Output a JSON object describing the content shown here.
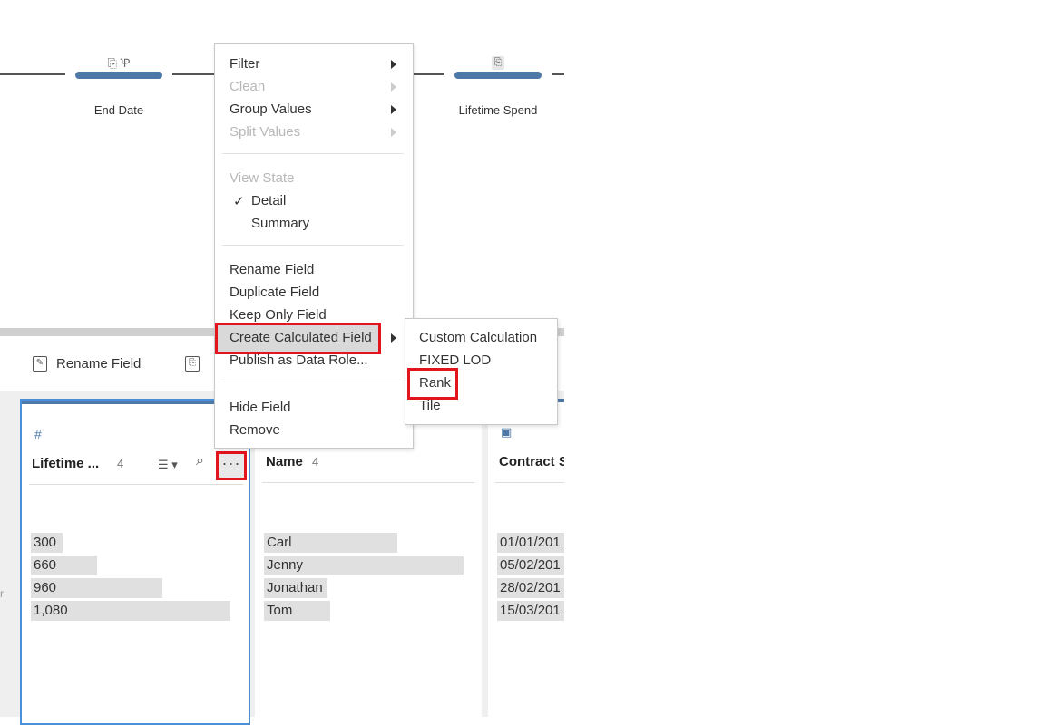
{
  "flow": {
    "node_end_date": {
      "label": "End Date",
      "icons": [
        "field-icon",
        "clean-icon"
      ]
    },
    "node_lifetime_spend": {
      "label": "Lifetime Spend",
      "icons": [
        "field-icon"
      ]
    }
  },
  "toolbar": {
    "rename_label": "Rename Field"
  },
  "cards": {
    "lifetime": {
      "type_glyph": "#",
      "title": "Lifetime ...",
      "count": "4",
      "values": [
        "300",
        "660",
        "960",
        "1,080"
      ],
      "fractions": [
        0.16,
        0.33,
        0.66,
        1.0
      ]
    },
    "name": {
      "title": "Name",
      "count": "4",
      "values": [
        "Carl",
        "Jenny",
        "Jonathan",
        "Tom"
      ],
      "fractions": [
        0.67,
        1.0,
        0.32,
        0.33
      ]
    },
    "contract": {
      "title": "Contract S",
      "values": [
        "01/01/201",
        "05/02/201",
        "28/02/201",
        "15/03/201"
      ]
    }
  },
  "menu": {
    "filter": "Filter",
    "clean": "Clean",
    "group_values": "Group Values",
    "split_values": "Split Values",
    "view_state": "View State",
    "check": "✓",
    "detail": "Detail",
    "summary": "Summary",
    "rename_field": "Rename Field",
    "duplicate_field": "Duplicate Field",
    "keep_only_field": "Keep Only Field",
    "create_calculated_field": "Create Calculated Field",
    "publish_as_data_role": "Publish as Data Role...",
    "hide_field": "Hide Field",
    "remove": "Remove"
  },
  "submenu": {
    "custom_calculation": "Custom Calculation",
    "fixed_lod": "FIXED LOD",
    "rank": "Rank",
    "tile": "Tile"
  },
  "more_button": "···",
  "gutter_letter": "r",
  "colors": {
    "accent": "#4e79a7",
    "highlight_border": "#e3141e",
    "selection": "#4a90d9"
  }
}
